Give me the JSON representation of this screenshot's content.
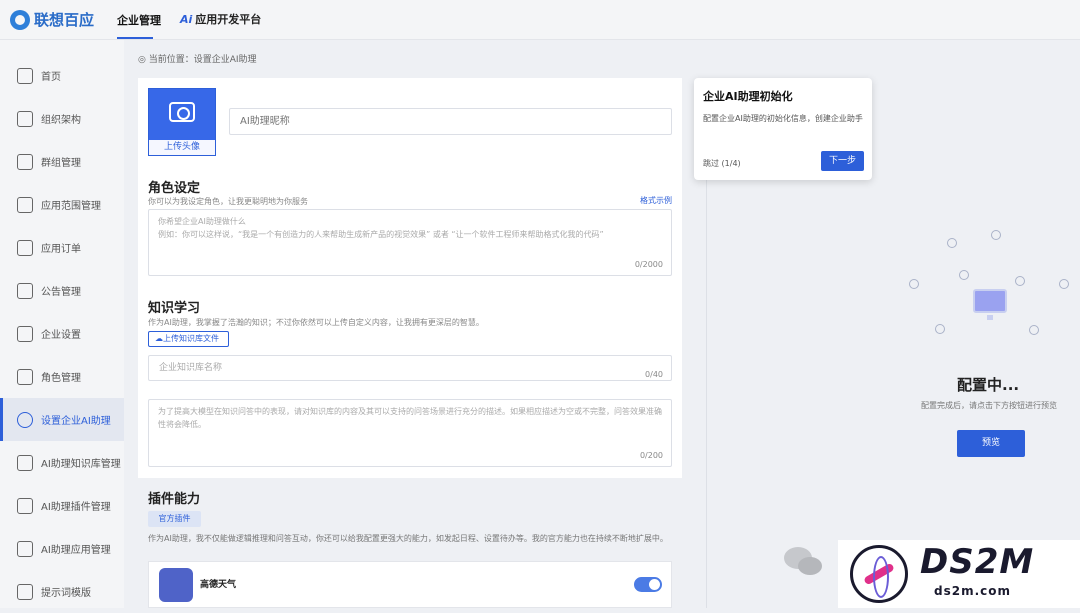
{
  "brand": {
    "name": "联想百应"
  },
  "topnav": {
    "enterprise": "企业管理",
    "platform_ai": "Ai",
    "platform": "应用开发平台"
  },
  "sidebar": {
    "items": [
      {
        "label": "首页"
      },
      {
        "label": "组织架构"
      },
      {
        "label": "群组管理"
      },
      {
        "label": "应用范围管理"
      },
      {
        "label": "应用订单"
      },
      {
        "label": "公告管理"
      },
      {
        "label": "企业设置"
      },
      {
        "label": "角色管理"
      },
      {
        "label": "设置企业AI助理"
      },
      {
        "label": "AI助理知识库管理"
      },
      {
        "label": "AI助理插件管理"
      },
      {
        "label": "AI助理应用管理"
      },
      {
        "label": "提示词模版"
      }
    ],
    "active_index": 8
  },
  "breadcrumb": {
    "text": "◎ 当前位置：设置企业AI助理"
  },
  "form": {
    "avatar_label": "上传头像",
    "name_placeholder": "AI助理昵称",
    "role": {
      "title": "角色设定",
      "desc": "你可以为我设定角色，让我更聪明地为你服务",
      "example_link": "格式示例",
      "placeholder_line1": "你希望企业AI助理做什么",
      "placeholder_line2": "例如：你可以这样说，“我是一个有创造力的人来帮助生成新产品的视觉效果” 或者 “让一个软件工程师来帮助格式化我的代码”",
      "counter": "0/2000"
    },
    "knowledge": {
      "title": "知识学习",
      "desc": "作为AI助理，我掌握了浩瀚的知识；不过你依然可以上传自定义内容，让我拥有更深层的智慧。",
      "upload_label": "上传知识库文件",
      "name_placeholder": "企业知识库名称",
      "name_counter": "0/40",
      "desc_placeholder": "为了提高大模型在知识问答中的表现，请对知识库的内容及其可以支持的问答场景进行充分的描述。如果相应描述为空或不完整，问答效果准确性将会降低。",
      "desc_counter": "0/200"
    }
  },
  "plugins": {
    "title": "插件能力",
    "tab": "官方插件",
    "desc": "作为AI助理，我不仅能做逻辑推理和问答互动，你还可以给我配置更强大的能力，如发起日程、设置待办等。我的官方能力也在持续不断地扩展中。",
    "items": [
      {
        "name": "高德天气",
        "enabled": true
      }
    ]
  },
  "preview": {
    "title": "配置中...",
    "desc": "配置完成后，请点击下方按钮进行预览",
    "button": "预览"
  },
  "tour": {
    "title": "企业AI助理初始化",
    "desc": "配置企业AI助理的初始化信息，创建企业助手",
    "skip": "跳过 (1/4)",
    "next": "下一步"
  },
  "watermark": {
    "text": "DS2M",
    "sub": "ds2m.com"
  }
}
